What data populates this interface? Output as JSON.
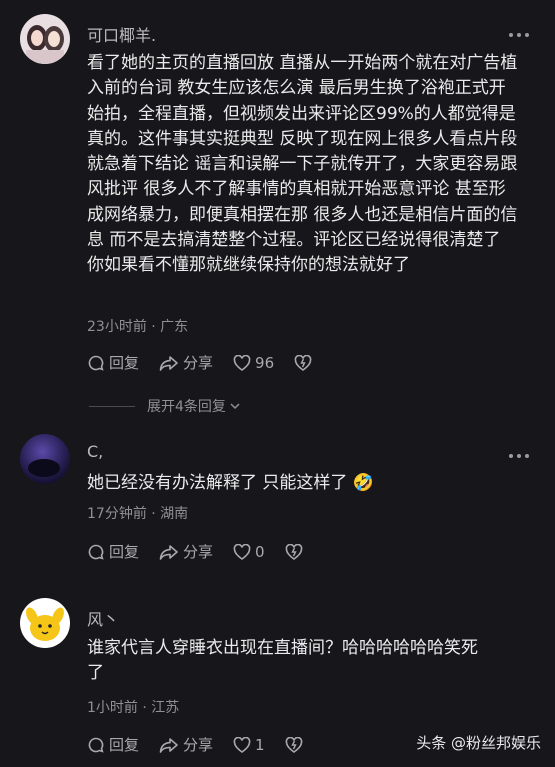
{
  "comments": [
    {
      "user": "可口椰羊.",
      "lines": [
        "看了她的主页的直播回放 直播从一开始两个就在对广告植",
        "入前的台词 教女生应该怎么演 最后男生换了浴袍正式开",
        "始拍，全程直播，但视频发出来评论区99%的人都觉得是",
        "真的。这件事其实挺典型 反映了现在网上很多人看点片段",
        "就急着下结论 谣言和误解一下子就传开了，大家更容易跟",
        "风批评 很多人不了解事情的真相就开始恶意评论 甚至形",
        "成网络暴力，即便真相摆在那 很多人也还是相信片面的信",
        "息 而不是去搞清楚整个过程。评论区已经说得很清楚了",
        "你如果看不懂那就继续保持你的想法就好了"
      ],
      "meta": "23小时前 · 广东",
      "reply": "回复",
      "share": "分享",
      "likes": "96",
      "expand": "展开4条回复"
    },
    {
      "user": "C,",
      "lines": [
        "她已经没有办法解释了 只能这样了 🤣"
      ],
      "meta": "17分钟前 · 湖南",
      "reply": "回复",
      "share": "分享",
      "likes": "0"
    },
    {
      "user": "风丶",
      "lines": [
        "谁家代言人穿睡衣出现在直播间？哈哈哈哈哈哈笑死",
        "了"
      ],
      "meta": "1小时前 · 江苏",
      "reply": "回复",
      "share": "分享",
      "likes": "1"
    }
  ],
  "watermark": "头条 @粉丝邦娱乐",
  "icons": [
    "more-icon",
    "comment-icon",
    "share-icon",
    "heart-icon",
    "dislike-heart-icon",
    "chevron-down-icon"
  ]
}
